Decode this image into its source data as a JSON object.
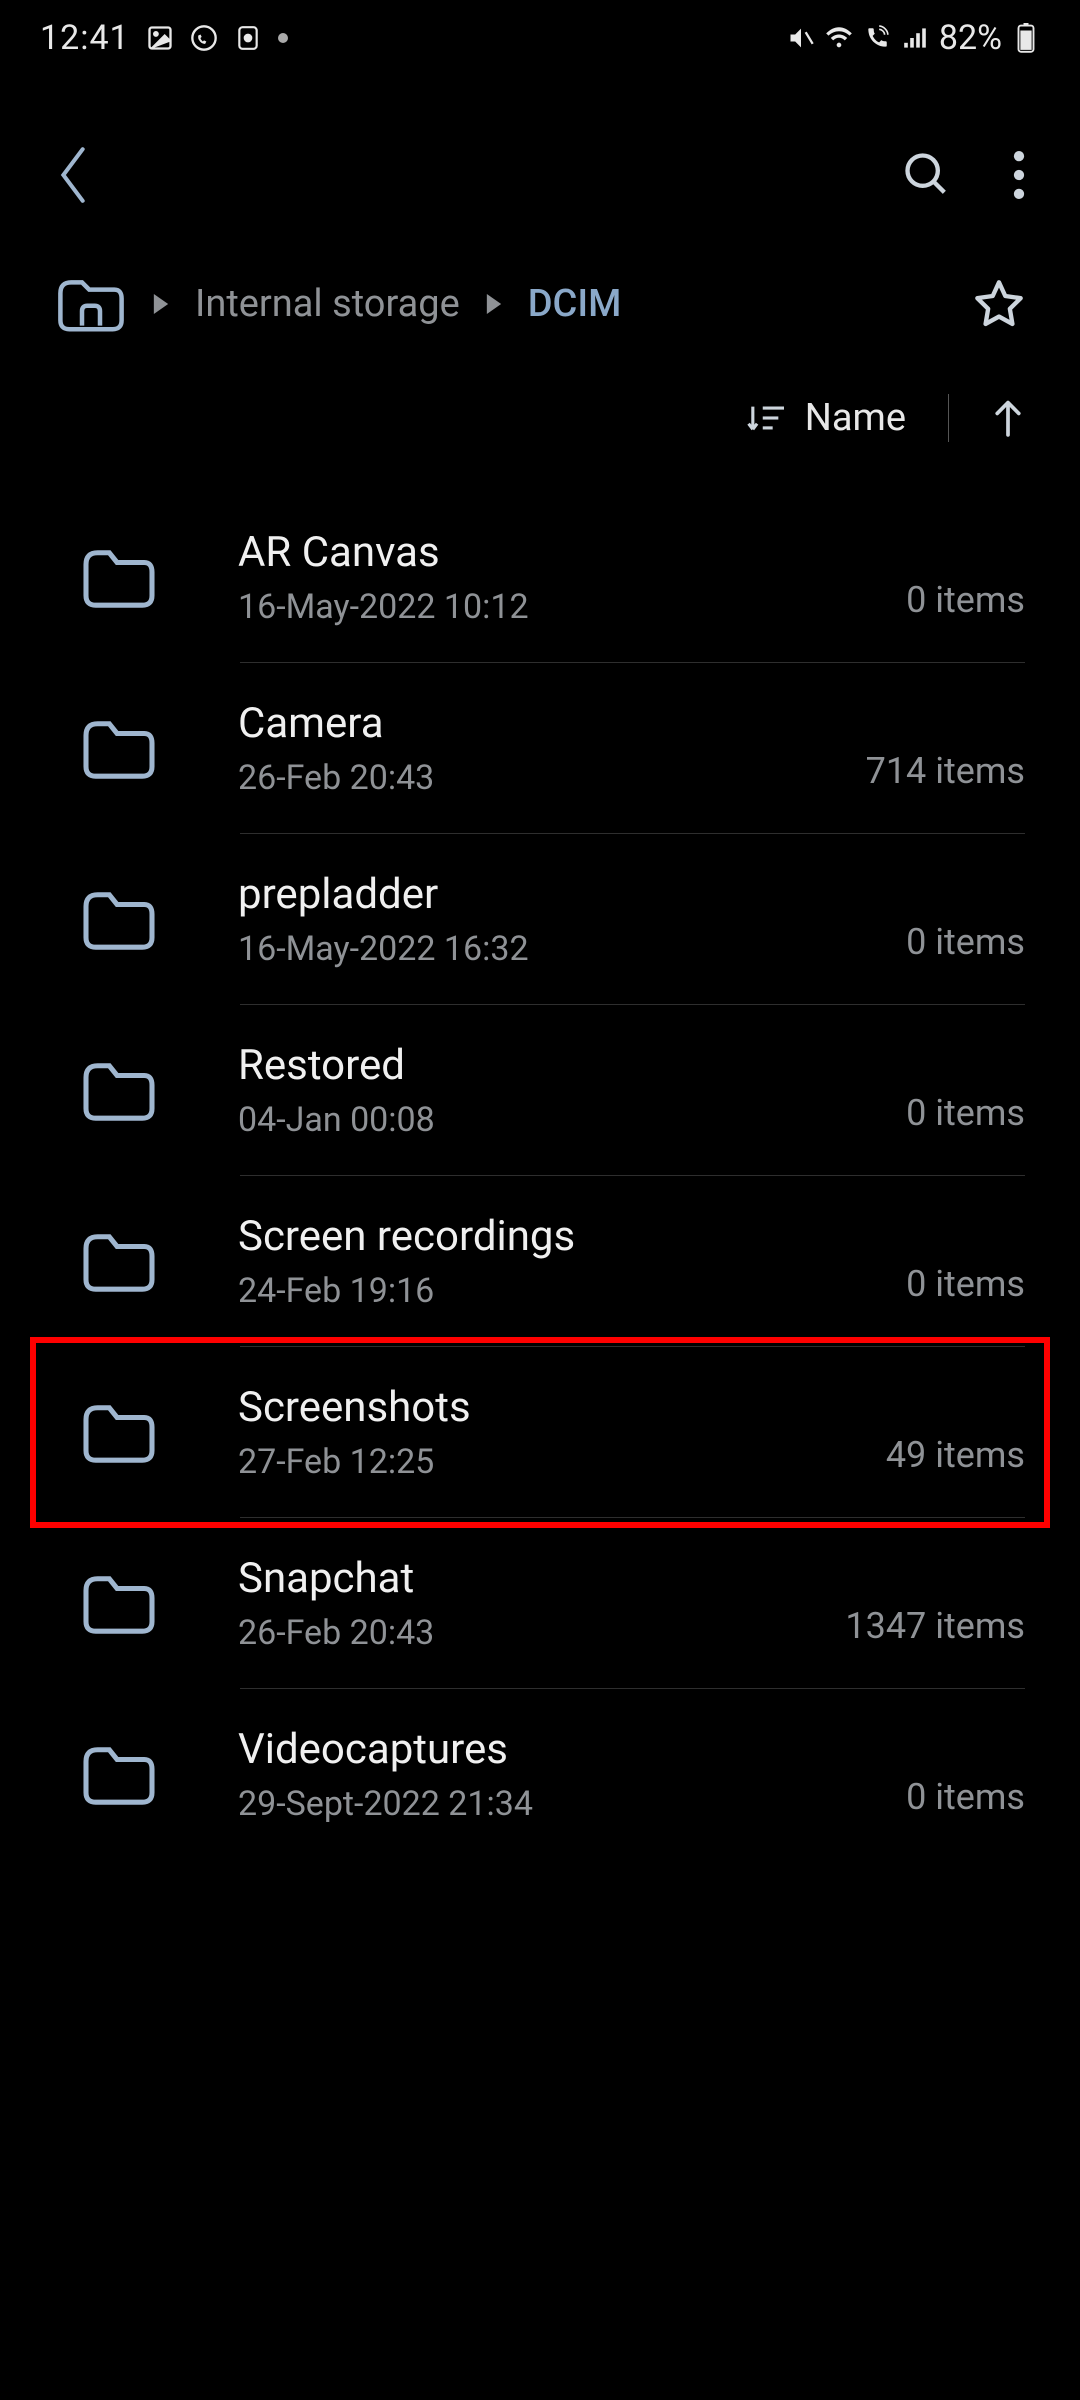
{
  "status": {
    "time": "12:41",
    "battery": "82%"
  },
  "breadcrumb": {
    "root_label": "Internal storage",
    "current": "DCIM"
  },
  "sort": {
    "label": "Name"
  },
  "folders": [
    {
      "name": "AR Canvas",
      "date": "16-May-2022 10:12",
      "count": "0 items",
      "highlighted": false
    },
    {
      "name": "Camera",
      "date": "26-Feb 20:43",
      "count": "714 items",
      "highlighted": false
    },
    {
      "name": "prepladder",
      "date": "16-May-2022 16:32",
      "count": "0 items",
      "highlighted": false
    },
    {
      "name": "Restored",
      "date": "04-Jan 00:08",
      "count": "0 items",
      "highlighted": false
    },
    {
      "name": "Screen recordings",
      "date": "24-Feb 19:16",
      "count": "0 items",
      "highlighted": false
    },
    {
      "name": "Screenshots",
      "date": "27-Feb 12:25",
      "count": "49 items",
      "highlighted": true
    },
    {
      "name": "Snapchat",
      "date": "26-Feb 20:43",
      "count": "1347 items",
      "highlighted": false
    },
    {
      "name": "Videocaptures",
      "date": "29-Sept-2022 21:34",
      "count": "0 items",
      "highlighted": false
    }
  ]
}
